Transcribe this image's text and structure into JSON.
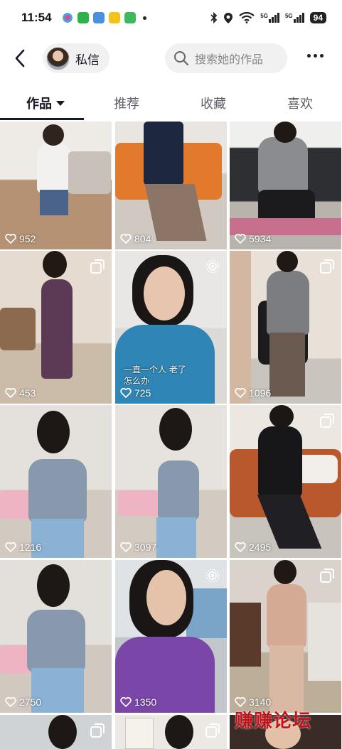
{
  "status_bar": {
    "time": "11:54",
    "signal_1": "5G",
    "signal_2": "5G",
    "battery": "94"
  },
  "header": {
    "dm_label": "私信",
    "search_placeholder": "搜索她的作品"
  },
  "tabs": [
    {
      "label": "作品",
      "active": true
    },
    {
      "label": "推荐",
      "active": false
    },
    {
      "label": "收藏",
      "active": false
    },
    {
      "label": "喜欢",
      "active": false
    }
  ],
  "videos": [
    {
      "likes": "952"
    },
    {
      "likes": "804"
    },
    {
      "likes": "5934"
    },
    {
      "likes": "453",
      "badge": "multi-image-icon"
    },
    {
      "likes": "725",
      "badge": "live-photo-icon",
      "caption": "一直一个人 老了怎么办"
    },
    {
      "likes": "1096",
      "badge": "multi-image-icon"
    },
    {
      "likes": "1216"
    },
    {
      "likes": "3097"
    },
    {
      "likes": "2495",
      "badge": "multi-image-icon"
    },
    {
      "likes": "2750"
    },
    {
      "likes": "1350",
      "badge": "live-photo-icon"
    },
    {
      "likes": "3140",
      "badge": "multi-image-icon"
    }
  ],
  "watermark": "赚赚论坛"
}
